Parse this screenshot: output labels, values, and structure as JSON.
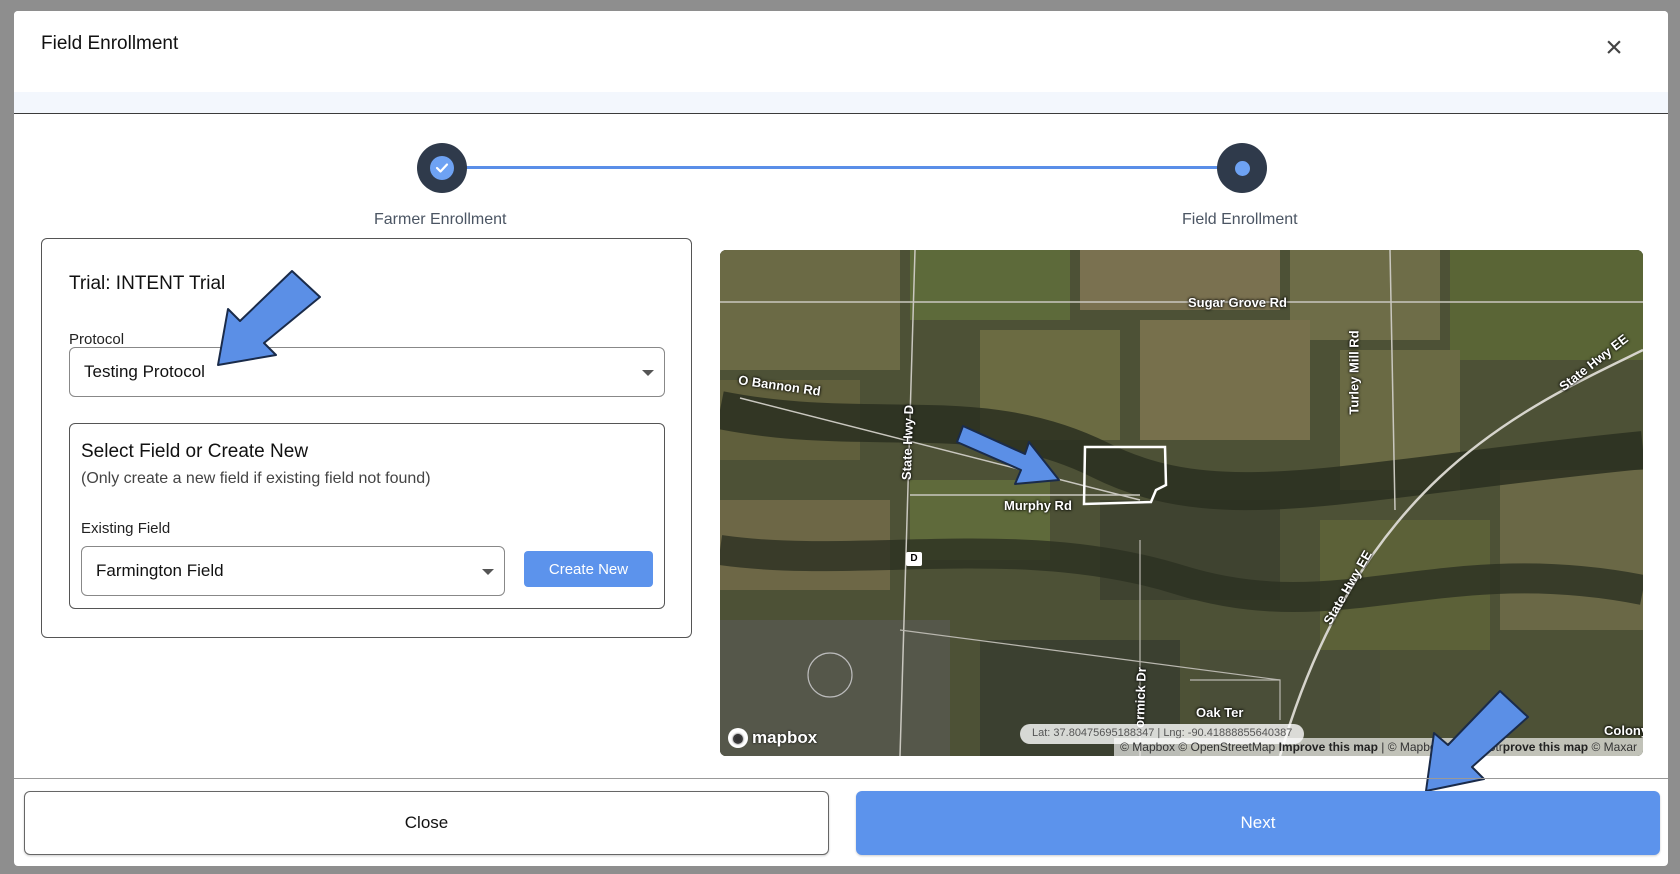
{
  "modal": {
    "title": "Field Enrollment",
    "close_icon": "close-icon"
  },
  "stepper": {
    "steps": [
      {
        "label": "Farmer Enrollment",
        "status": "done"
      },
      {
        "label": "Field Enrollment",
        "status": "current"
      }
    ]
  },
  "form": {
    "trial_title": "Trial: INTENT Trial",
    "protocol": {
      "label": "Protocol",
      "value": "Testing Protocol"
    },
    "field_section": {
      "title": "Select Field or Create New",
      "subtitle": "(Only create a new field if existing field not found)",
      "existing_label": "Existing Field",
      "existing_value": "Farmington Field",
      "create_button": "Create New"
    }
  },
  "map": {
    "labels": {
      "sugar_grove": "Sugar Grove Rd",
      "obannon": "O Bannon Rd",
      "state_hwy_d": "State Hwy D",
      "murphy": "Murphy Rd",
      "turley": "Turley Mill Rd",
      "state_hwy_ee_top": "State Hwy EE",
      "state_hwy_ee_mid": "State Hwy EE",
      "mccormick": "ormick Dr",
      "oak_ter": "Oak Ter",
      "colony": "Colony",
      "route_d": "D"
    },
    "logo": "mapbox",
    "coords": "Lat: 37.80475695188347 | Lng: -90.41888855640387",
    "attribution": {
      "part1": "© Mapbox © OpenStreetMap ",
      "improve1": "Improve this map",
      "part2": " | © Mapbox © OpenStr",
      "improve2": "prove this map",
      "part3": " © Maxar"
    }
  },
  "footer": {
    "close_label": "Close",
    "next_label": "Next"
  },
  "colors": {
    "accent": "#5c93ec",
    "stepper_dark": "#2f3a4b",
    "annotation_arrow": "#5b8fe6"
  }
}
